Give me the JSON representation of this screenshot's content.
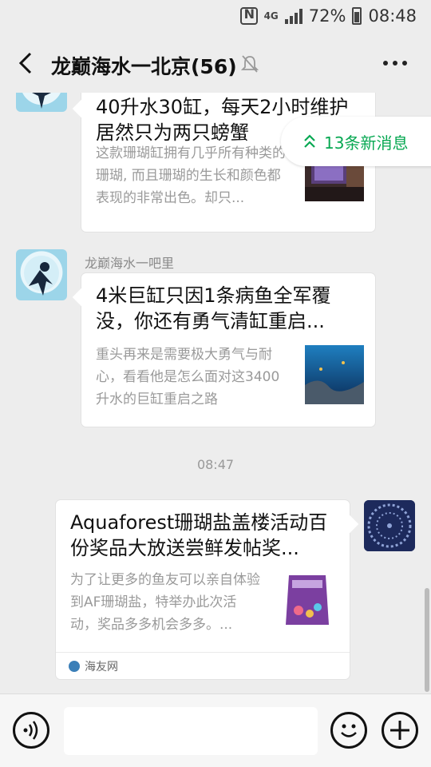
{
  "status_bar": {
    "network": "4G",
    "battery": "72%",
    "time": "08:48"
  },
  "header": {
    "title": "龙巅海水一北京(56)"
  },
  "new_messages": {
    "label": "13条新消息"
  },
  "messages": [
    {
      "sender": "",
      "title": "40升水30缸，每天2小时维护居然只为两只螃蟹",
      "desc": "这款珊瑚缸拥有几乎所有种类的珊瑚, 而且珊瑚的生长和颜色都表现的非常出色。却只..."
    },
    {
      "sender": "龙巅海水一吧里",
      "title": "4米巨缸只因1条病鱼全军覆没，你还有勇气清缸重启...",
      "desc": "重头再来是需要极大勇气与耐心，看看他是怎么面对这3400升水的巨缸重启之路"
    },
    {
      "time": "08:47"
    },
    {
      "title": "Aquaforest珊瑚盐盖楼活动百份奖品大放送尝鲜发帖奖...",
      "desc": "为了让更多的鱼友可以亲自体验到AF珊瑚盐，特举办此次活动，奖品多多机会多多。...",
      "source": "海友网"
    }
  ],
  "input": {
    "placeholder": ""
  },
  "colors": {
    "accent_green": "#07a852",
    "background": "#ededed"
  }
}
